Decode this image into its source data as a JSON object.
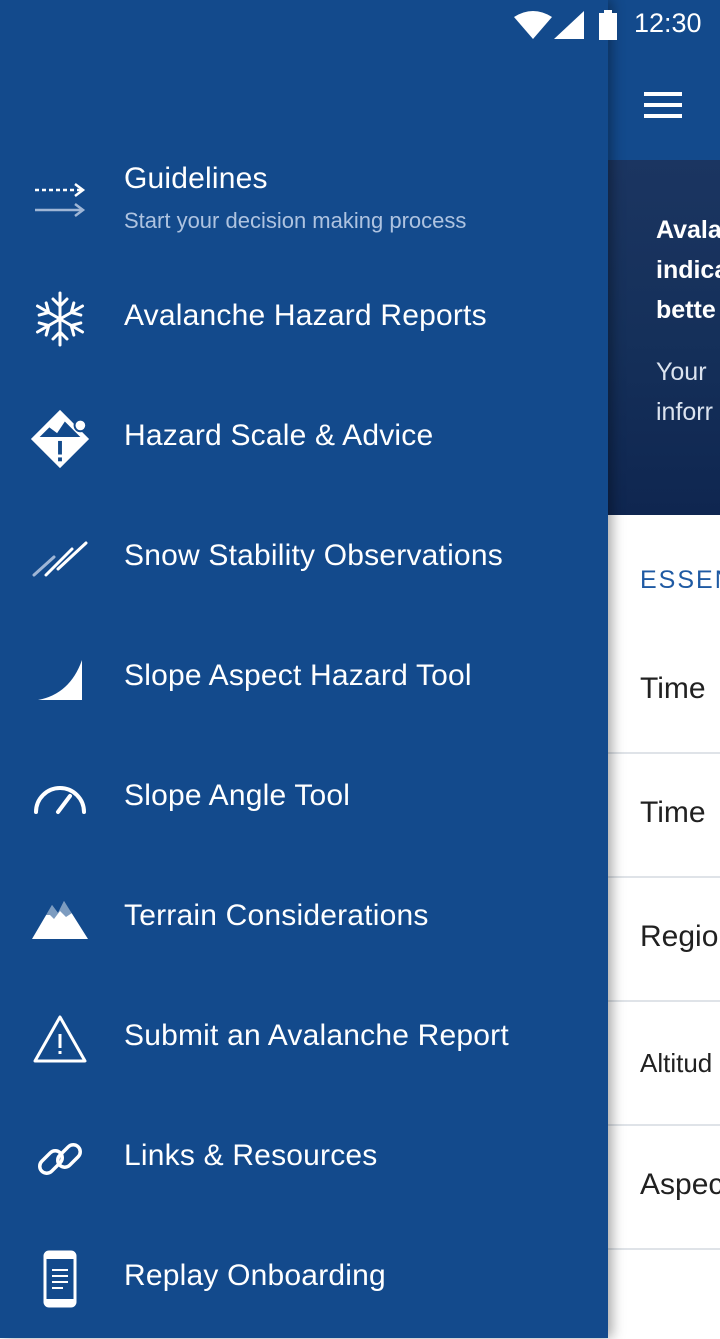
{
  "status_bar": {
    "time": "12:30",
    "icons": [
      "wifi-icon",
      "signal-icon",
      "battery-icon"
    ]
  },
  "colors": {
    "drawer_bg": "#134a8c",
    "accent": "#1f5aa3",
    "text_light": "#ffffff",
    "subtitle": "#aec3e0"
  },
  "drawer": {
    "items": [
      {
        "label": "Guidelines",
        "subtitle": "Start your decision making process",
        "icon": "arrows-icon"
      },
      {
        "label": "Avalanche Hazard Reports",
        "icon": "snowflake-icon"
      },
      {
        "label": "Hazard Scale & Advice",
        "icon": "hazard-diamond-icon"
      },
      {
        "label": "Snow Stability Observations",
        "icon": "stability-lines-icon"
      },
      {
        "label": "Slope Aspect Hazard Tool",
        "icon": "slope-icon"
      },
      {
        "label": "Slope Angle Tool",
        "icon": "gauge-icon"
      },
      {
        "label": "Terrain Considerations",
        "icon": "mountain-icon"
      },
      {
        "label": "Submit an Avalanche Report",
        "icon": "warning-triangle-icon"
      },
      {
        "label": "Links & Resources",
        "icon": "link-icon"
      },
      {
        "label": "Replay Onboarding",
        "icon": "phone-icon"
      }
    ]
  },
  "main": {
    "hero": {
      "bold_lines": [
        "Avala",
        "indica",
        "bette"
      ],
      "body_lines": [
        "Your",
        "inforr"
      ]
    },
    "section_heading": "ESSEN",
    "rows": [
      "Time",
      "Time",
      "Regio",
      "Altitud",
      "Aspec"
    ]
  }
}
